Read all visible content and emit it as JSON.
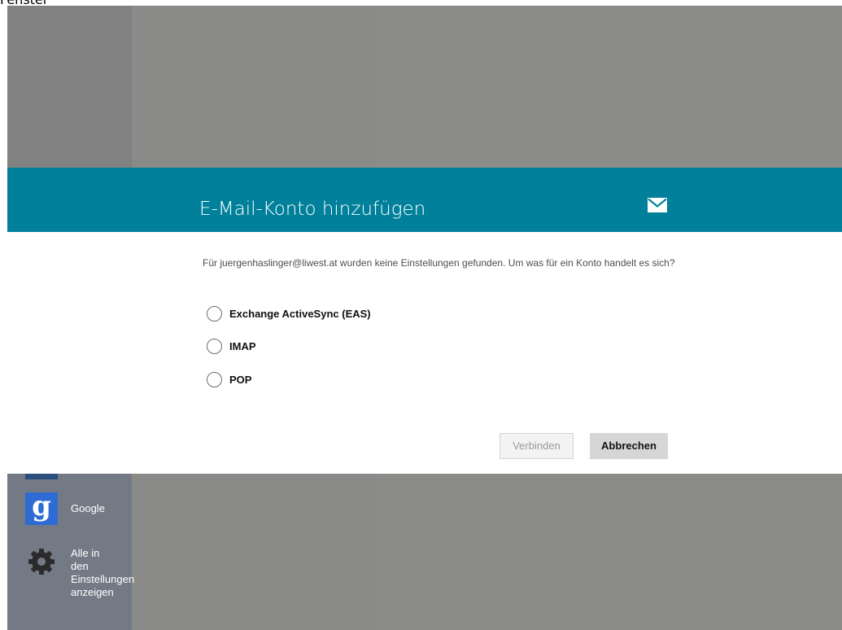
{
  "top_caption": "Fenster",
  "dialog": {
    "title": "E-Mail-Konto hinzufügen",
    "message": "Für juergenhaslinger@liwest.at wurden keine Einstellungen gefunden. Um was für ein Konto handelt es sich?",
    "options": [
      {
        "label": "Exchange ActiveSync (EAS)",
        "selected": false
      },
      {
        "label": "IMAP",
        "selected": false
      },
      {
        "label": "POP",
        "selected": false
      }
    ],
    "buttons": {
      "connect_label": "Verbinden",
      "cancel_label": "Abbrechen"
    }
  },
  "background": {
    "providers": [
      {
        "label": "Google",
        "icon": "google-icon"
      },
      {
        "label": "Alle in\nden\nEinstellungen\nanzeigen",
        "icon": "gear-icon"
      }
    ]
  },
  "colors": {
    "header": "#00809a",
    "overlay": "#8a8b88",
    "sidebar": "#737a86"
  }
}
